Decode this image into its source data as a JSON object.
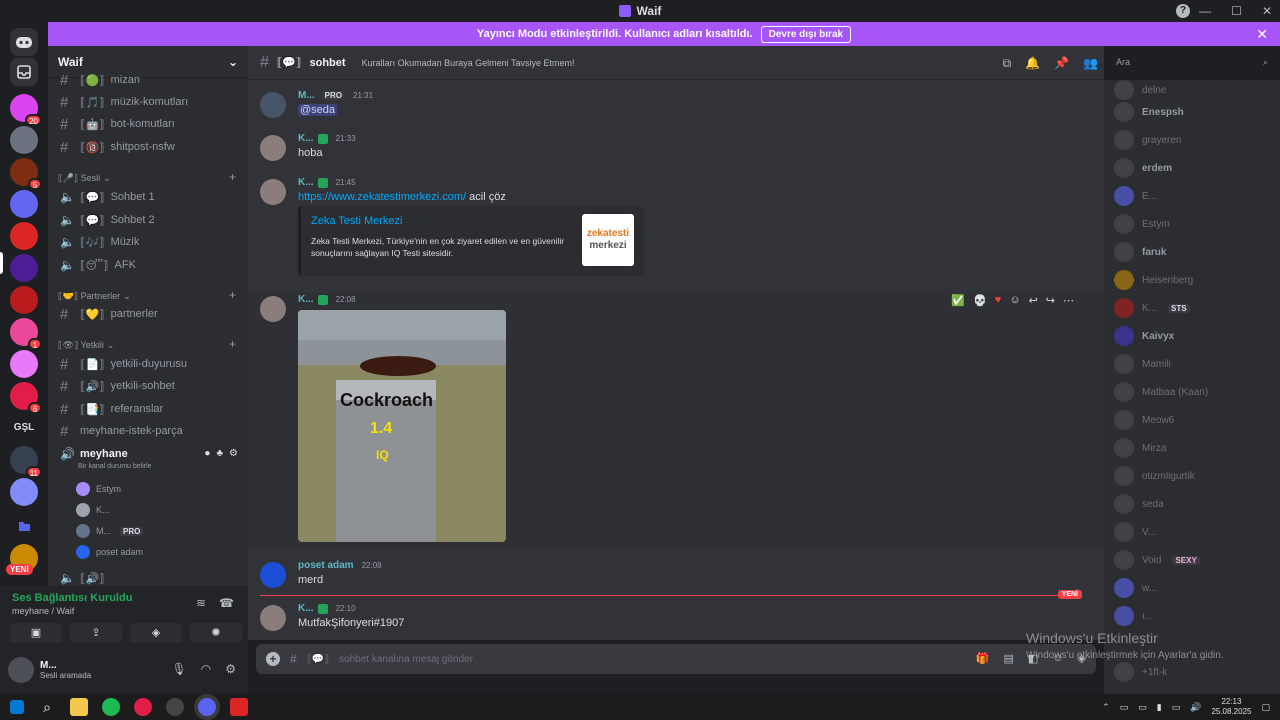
{
  "window": {
    "title": "Waif"
  },
  "banner": {
    "text": "Yayıncı Modu etkinleştirildi. Kullanıcı adları kısaltıldı.",
    "button": "Devre dışı bırak"
  },
  "server": {
    "name": "Waif"
  },
  "guild_badges": [
    "20",
    "5",
    "1",
    "6",
    "11"
  ],
  "guild_labels": {
    "gsl": "GŞL",
    "yeni": "YENİ"
  },
  "channels": [
    {
      "name": "mizan",
      "type": "text",
      "prefix": "⟦🟢⟧"
    },
    {
      "name": "müzik-komutları",
      "type": "text",
      "prefix": "⟦🎵⟧"
    },
    {
      "name": "bot-komutları",
      "type": "text",
      "prefix": "⟦🤖⟧"
    },
    {
      "name": "shitpost-nsfw",
      "type": "text",
      "prefix": "⟦🔞⟧"
    }
  ],
  "categories": {
    "sesli": "⟦🎤⟧ Sesli",
    "partnerler": "⟦🤝⟧ Partnerler",
    "yetkili": "⟦👁⟧ Yetkili"
  },
  "voice_channels": [
    {
      "name": "Sohbet 1",
      "prefix": "⟦💬⟧"
    },
    {
      "name": "Sohbet 2",
      "prefix": "⟦💬⟧"
    },
    {
      "name": "Müzik",
      "prefix": "⟦🎶⟧"
    },
    {
      "name": "AFK",
      "prefix": "⟦😴⟧"
    }
  ],
  "partner_channels": [
    {
      "name": "partnerler",
      "prefix": "⟦💛⟧"
    }
  ],
  "staff_channels": [
    {
      "name": "yetkili-duyurusu",
      "prefix": "⟦📄⟧"
    },
    {
      "name": "yetkili-sohbet",
      "prefix": "⟦🔊⟧"
    },
    {
      "name": "referanslar",
      "prefix": "⟦📑⟧"
    },
    {
      "name": "meyhane-istek-parça",
      "prefix": ""
    }
  ],
  "active_voice": {
    "name": "meyhane",
    "status": "Bir kanal durumu belirle",
    "users": [
      "Estym",
      "K...",
      "M...",
      "poset adam"
    ],
    "pro_label": "PRO",
    "next_channel": "⟦🔊⟧"
  },
  "voice_panel": {
    "title": "Ses Bağlantısı Kuruldu",
    "subtitle": "meyhane / Waif"
  },
  "user": {
    "name": "M...",
    "status": "Sesli aramada"
  },
  "chat": {
    "channel_prefix": "⟦💬⟧",
    "channel": "sohbet",
    "topic": "Kuralları Okumadan Buraya Gelmeni Tavsiye Etmem!",
    "search_placeholder": "Ara",
    "composer_placeholder": "sohbet kanalına mesaj gönder"
  },
  "messages": [
    {
      "author": "M...",
      "badge": "PRO",
      "time": "21:31",
      "mention": "@seda"
    },
    {
      "author": "K...",
      "time": "21:33",
      "text": "hoba"
    },
    {
      "author": "K...",
      "time": "21:45",
      "link": "https://www.zekatestimerkezi.com/",
      "text": "acil çöz",
      "embed": {
        "title": "Zeka Testi Merkezi",
        "description": "Zeka Testi Merkezi, Türkiye'nin en çok ziyaret edilen ve en güvenilir sonuçlarını sağlayan IQ Testi sitesidir.",
        "thumb_top": "zekatesti",
        "thumb_bottom": "merkezi"
      }
    },
    {
      "author": "K...",
      "time": "22:08",
      "image": {
        "label": "Cockroach",
        "iq": "1.4",
        "unit": "IQ"
      }
    },
    {
      "author": "poset adam",
      "time": "22:08",
      "text": "merd"
    },
    {
      "author": "K...",
      "time": "22:10",
      "text": "MutfakŞifonyeri#1907"
    }
  ],
  "new_divider": "YENİ",
  "members": [
    {
      "name": "delne"
    },
    {
      "name": "Enespsh",
      "bold": true
    },
    {
      "name": "grayeren"
    },
    {
      "name": "erdem",
      "bold": true
    },
    {
      "name": "E..."
    },
    {
      "name": "Estym"
    },
    {
      "name": "faruk",
      "bold": true
    },
    {
      "name": "Heisenberg"
    },
    {
      "name": "K...",
      "tag": "STS"
    },
    {
      "name": "Kaivyx",
      "bold": true
    },
    {
      "name": "Mamili"
    },
    {
      "name": "Matbaa (Kaan)"
    },
    {
      "name": "Meow6"
    },
    {
      "name": "Mirza"
    },
    {
      "name": "otizmligurtik"
    },
    {
      "name": "seda"
    },
    {
      "name": "V..."
    },
    {
      "name": "Void",
      "tag": "SEXY"
    },
    {
      "name": "w..."
    },
    {
      "name": "ı..."
    },
    {
      "name": "+1ft-k"
    }
  ],
  "watermark": {
    "line1": "Windows'u Etkinleştir",
    "line2": "Windows'u etkinleştirmek için Ayarlar'a gidin."
  },
  "clock": {
    "time": "22:13",
    "date": "25.08.2025"
  },
  "colors": {
    "accent": "#a855f7",
    "online": "#23a55a",
    "link": "#00a8fc",
    "danger": "#f23f43"
  }
}
